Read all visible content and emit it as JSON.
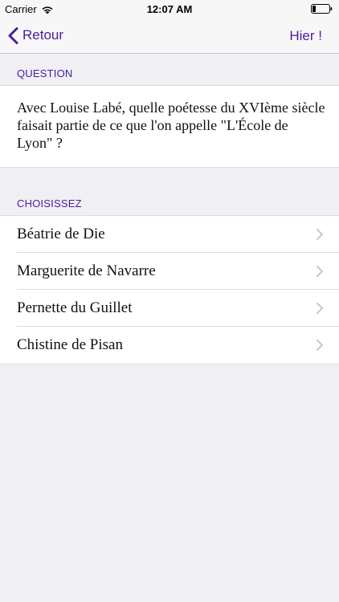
{
  "status_bar": {
    "carrier": "Carrier",
    "time": "12:07 AM"
  },
  "nav": {
    "back_label": "Retour",
    "right_label": "Hier !"
  },
  "question_section": {
    "header": "QUESTION",
    "text": "Avec Louise Labé, quelle poétesse du XVIème siècle faisait partie de ce que l'on appelle \"L'École de Lyon\" ?"
  },
  "choices_section": {
    "header": "CHOISISSEZ",
    "items": [
      {
        "label": "Béatrie de Die"
      },
      {
        "label": "Marguerite de Navarre"
      },
      {
        "label": "Pernette du Guillet"
      },
      {
        "label": "Chistine de Pisan"
      }
    ]
  },
  "colors": {
    "accent": "#4a1e99",
    "background": "#efeff4",
    "surface": "#ffffff"
  },
  "icons": {
    "back": "chevron-left-icon",
    "row": "chevron-right-icon",
    "wifi": "wifi-icon",
    "battery": "battery-icon"
  }
}
